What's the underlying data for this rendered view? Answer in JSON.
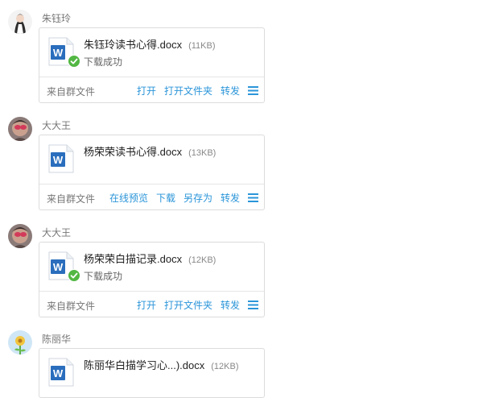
{
  "messages": [
    {
      "sender": "朱钰玲",
      "file_name": "朱钰玲读书心得.docx",
      "file_size": "(11KB)",
      "status": "下载成功",
      "source": "来自群文件",
      "actions": [
        "打开",
        "打开文件夹",
        "转发"
      ]
    },
    {
      "sender": "大大王",
      "file_name": "杨荣荣读书心得.docx",
      "file_size": "(13KB)",
      "status": "",
      "source": "来自群文件",
      "actions": [
        "在线预览",
        "下载",
        "另存为",
        "转发"
      ]
    },
    {
      "sender": "大大王",
      "file_name": "杨荣荣白描记录.docx",
      "file_size": "(12KB)",
      "status": "下载成功",
      "source": "来自群文件",
      "actions": [
        "打开",
        "打开文件夹",
        "转发"
      ]
    },
    {
      "sender": "陈丽华",
      "file_name": "陈丽华白描学习心...).docx",
      "file_size": "(12KB)"
    }
  ],
  "colors": {
    "link": "#2b95d9",
    "word_blue": "#2a6ebd",
    "success_green": "#52b743"
  },
  "icons": [
    "word-file-icon",
    "success-check-icon",
    "menu-icon"
  ]
}
